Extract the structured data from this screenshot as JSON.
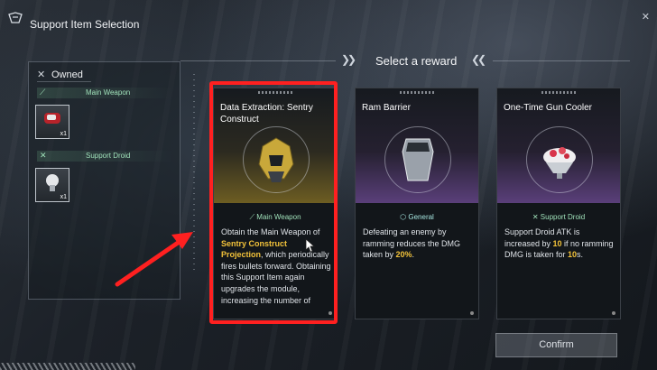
{
  "window": {
    "title": "Support Item Selection"
  },
  "header": {
    "select_reward": "Select a reward"
  },
  "owned": {
    "title": "Owned",
    "groups": [
      {
        "label": "Main Weapon",
        "icon": "sword-icon",
        "item_qty": "x1"
      },
      {
        "label": "Support Droid",
        "icon": "crossed-tools-icon",
        "item_qty": "x1"
      }
    ]
  },
  "cards": [
    {
      "name": "Data Extraction: Sentry Construct",
      "category": "Main Weapon",
      "category_icon": "sword-icon",
      "desc_parts": [
        "Obtain the Main Weapon of ",
        "Sentry Construct Projection",
        ", which periodically fires bullets forward. Obtaining this Support Item again upgrades the module, increasing the number of"
      ],
      "accent": "#c9a83a"
    },
    {
      "name": "Ram Barrier",
      "category": "General",
      "category_icon": "shield-icon",
      "desc_parts": [
        "Defeating an enemy by ramming reduces the DMG taken by ",
        "20%",
        "."
      ],
      "accent": "#8c5fc2"
    },
    {
      "name": "One-Time Gun Cooler",
      "category": "Support Droid",
      "category_icon": "crossed-tools-icon",
      "desc_parts": [
        "Support Droid ATK is increased by ",
        "10",
        " if no ramming DMG is taken for ",
        "10",
        "s."
      ],
      "accent": "#8c5fc2"
    }
  ],
  "confirm_label": "Confirm",
  "colors": {
    "highlight": "#ff2020",
    "keyword": "#f2c23a",
    "category": "#9fe0b9"
  }
}
